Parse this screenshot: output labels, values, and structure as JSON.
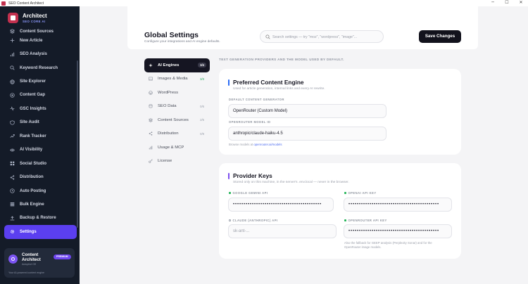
{
  "window": {
    "title": "SEO Content Architect",
    "controls": [
      "─",
      "☐",
      "✕"
    ]
  },
  "brand": {
    "name": "Architect",
    "tagline": "SEO CORE AI"
  },
  "sidebar": {
    "items": [
      {
        "label": "Content Sources",
        "icon": "layers-icon"
      },
      {
        "label": "New Article",
        "icon": "plus-icon"
      },
      {
        "label": "SEO Analysis",
        "icon": "chart-icon"
      },
      {
        "label": "Keyword Research",
        "icon": "search-icon"
      },
      {
        "label": "Site Explorer",
        "icon": "globe-icon"
      },
      {
        "label": "Content Gap",
        "icon": "target-icon"
      },
      {
        "label": "GSC Insights",
        "icon": "activity-icon"
      },
      {
        "label": "Site Audit",
        "icon": "shield-icon"
      },
      {
        "label": "Rank Tracker",
        "icon": "trend-icon"
      },
      {
        "label": "AI Visibility",
        "icon": "eye-icon"
      },
      {
        "label": "Social Studio",
        "icon": "grid-icon"
      },
      {
        "label": "Distribution",
        "icon": "share-icon"
      },
      {
        "label": "Auto Posting",
        "icon": "clock-icon"
      },
      {
        "label": "Bulk Engine",
        "icon": "stack-icon"
      },
      {
        "label": "Backup & Restore",
        "icon": "upload-icon"
      },
      {
        "label": "Settings",
        "icon": "gear-icon"
      }
    ]
  },
  "user": {
    "name": "Content Architect",
    "badge": "PREMIUM",
    "status": "Autopilot Off",
    "description": "Your AI-powered content engine"
  },
  "header": {
    "title": "Global Settings",
    "subtitle": "Configure your integrations and AI engine defaults.",
    "search_placeholder": "Search settings — try \"moz\", \"wordpress\", \"image\"...",
    "save_label": "Save Changes"
  },
  "tabs": [
    {
      "label": "AI Engines",
      "count": "3/4",
      "icon": "sparkle-icon"
    },
    {
      "label": "Images & Media",
      "count": "3/3",
      "icon": "image-icon"
    },
    {
      "label": "WordPress",
      "count": "",
      "icon": "wordpress-icon"
    },
    {
      "label": "SEO Data",
      "count": "0/6",
      "icon": "database-icon"
    },
    {
      "label": "Content Sources",
      "count": "2/5",
      "icon": "layers-icon"
    },
    {
      "label": "Distribution",
      "count": "0/9",
      "icon": "share-icon"
    },
    {
      "label": "Usage & MCP",
      "count": "",
      "icon": "chart-icon"
    },
    {
      "label": "License",
      "count": "",
      "icon": "key-icon"
    }
  ],
  "content": {
    "caption": "TEXT GENERATION PROVIDERS AND THE MODEL USED BY DEFAULT.",
    "preferred": {
      "title": "Preferred Content Engine",
      "subtitle": "Used for article generation, internal links and every AI rewrite.",
      "engine_label": "DEFAULT CONTENT GENERATOR",
      "engine_value": "OpenRouter (Custom Model)",
      "model_label": "OPENROUTER MODEL ID",
      "model_value": "anthropic/claude-haiku-4.5",
      "browse_prefix": "Browse models at ",
      "browse_link": "openrouter.ai/models"
    },
    "keys": {
      "title": "Provider Keys",
      "subtitle": "Stored only on this machine, in the server's .env.local — never in the browser.",
      "gemini_label": "GOOGLE GEMINI API",
      "gemini_value": "••••••••••••••••••••••••••••••••••••••••••",
      "openai_label": "OPENAI API KEY",
      "openai_value": "•••••••••••••••••••••••••••••••••••••••••••",
      "claude_label": "CLAUDE (ANTHROPIC) API",
      "claude_placeholder": "sk-ant-...",
      "openrouter_label": "OPENROUTER API KEY",
      "openrouter_value": "•••••••••••••••••••••••••••••••••••••••••••",
      "note_line1": "Also the fallback for GEEP analysis (Perplexity Sonar) and for the",
      "note_line2": "OpenRouter image models."
    }
  },
  "colors": {
    "accent": "#5b3ff0",
    "sidebar": "#141b28",
    "brand": "#c2304e",
    "success": "#21b356"
  }
}
